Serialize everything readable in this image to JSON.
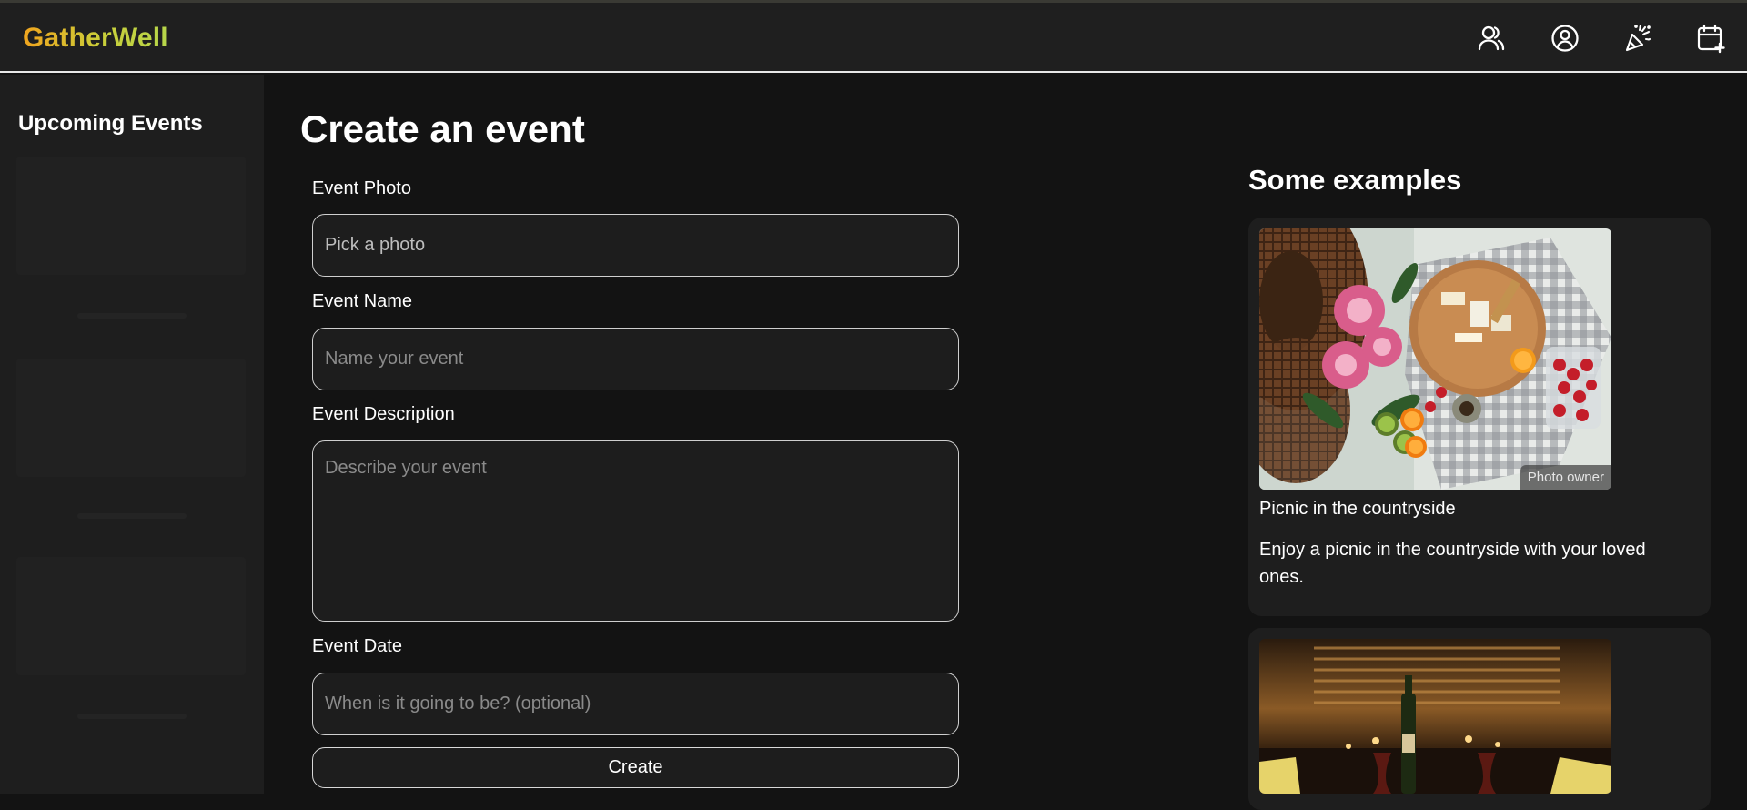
{
  "app": {
    "logo": "GatherWell"
  },
  "header": {
    "icons": [
      "friends-icon",
      "profile-icon",
      "party-popper-icon",
      "calendar-add-icon"
    ]
  },
  "sidebar": {
    "title": "Upcoming Events"
  },
  "form": {
    "title": "Create an event",
    "photo": {
      "label": "Event Photo",
      "placeholder": "Pick a photo"
    },
    "name": {
      "label": "Event Name",
      "placeholder": "Name your event"
    },
    "description": {
      "label": "Event Description",
      "placeholder": "Describe your event"
    },
    "date": {
      "label": "Event Date",
      "placeholder": "When is it going to be? (optional)"
    },
    "submit_label": "Create"
  },
  "examples": {
    "title": "Some examples",
    "items": [
      {
        "title": "Picnic in the countryside",
        "description": "Enjoy a picnic in the countryside with your loved ones.",
        "photo_credit": "Photo owner"
      }
    ]
  },
  "colors": {
    "background": "#131313",
    "header": "#1f1f1f",
    "logo_gradient": [
      "#f0a41e",
      "#b7d64a"
    ]
  }
}
